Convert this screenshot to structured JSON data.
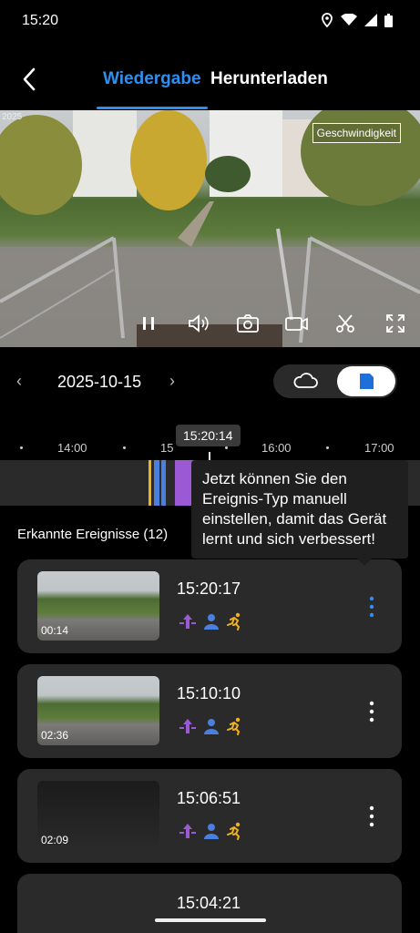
{
  "status_bar": {
    "time": "15:20"
  },
  "header": {
    "tab_playback": "Wiedergabe",
    "tab_download": "Herunterladen"
  },
  "video": {
    "speed_label": "Geschwindigkeit",
    "timestamp_overlay": "2025"
  },
  "date_bar": {
    "date": "2025-10-15",
    "prev": "‹",
    "next": "›"
  },
  "timeline": {
    "current_time": "15:20:14",
    "ticks": [
      "14:00",
      "15",
      "16:00",
      "17:00"
    ]
  },
  "tooltip": {
    "text": "Jetzt können Sie den Ereignis-Typ manuell einstellen, damit das Gerät lernt und sich verbessert!"
  },
  "events": {
    "title": "Erkannte Ereignisse (12)",
    "items": [
      {
        "time": "15:20:17",
        "duration": "00:14"
      },
      {
        "time": "15:10:10",
        "duration": "02:36"
      },
      {
        "time": "15:06:51",
        "duration": "02:09"
      },
      {
        "time": "15:04:21",
        "duration": ""
      }
    ]
  },
  "colors": {
    "accent": "#2e8ff0",
    "purple": "#9b59d6",
    "person_blue": "#4a7fe0",
    "motion_yellow": "#f2b21c"
  }
}
